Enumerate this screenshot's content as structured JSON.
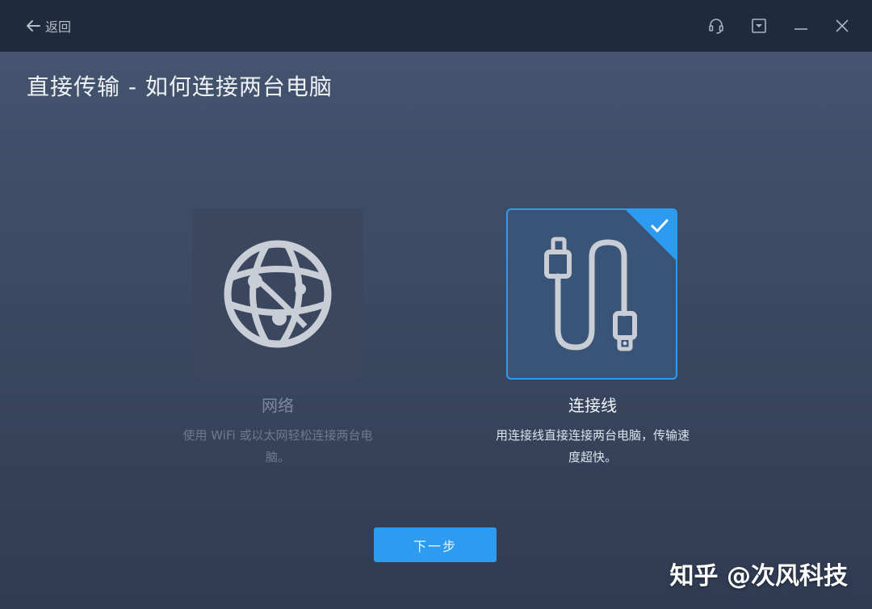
{
  "titlebar": {
    "back_label": "返回",
    "icons": [
      "back-arrow-icon",
      "support-headset-icon",
      "dropdown-menu-icon",
      "minimize-icon",
      "close-icon"
    ]
  },
  "page": {
    "title": "直接传输 - 如何连接两台电脑"
  },
  "options": [
    {
      "icon": "globe-icon",
      "title": "网络",
      "description_line1": "使用 WiFi 或以太网轻松连接两台电",
      "description_line2": "脑。",
      "selected": false
    },
    {
      "icon": "usb-cable-icon",
      "title": "连接线",
      "description_line1": "用连接线直接连接两台电脑，传输速",
      "description_line2": "度超快。",
      "selected": true
    }
  ],
  "actions": {
    "next_label": "下一步"
  },
  "watermark": {
    "text": "知乎 @次风科技"
  },
  "colors": {
    "accent": "#2d9cf0",
    "titlebar": "#1f2a3c",
    "background": "#3c4a63"
  }
}
